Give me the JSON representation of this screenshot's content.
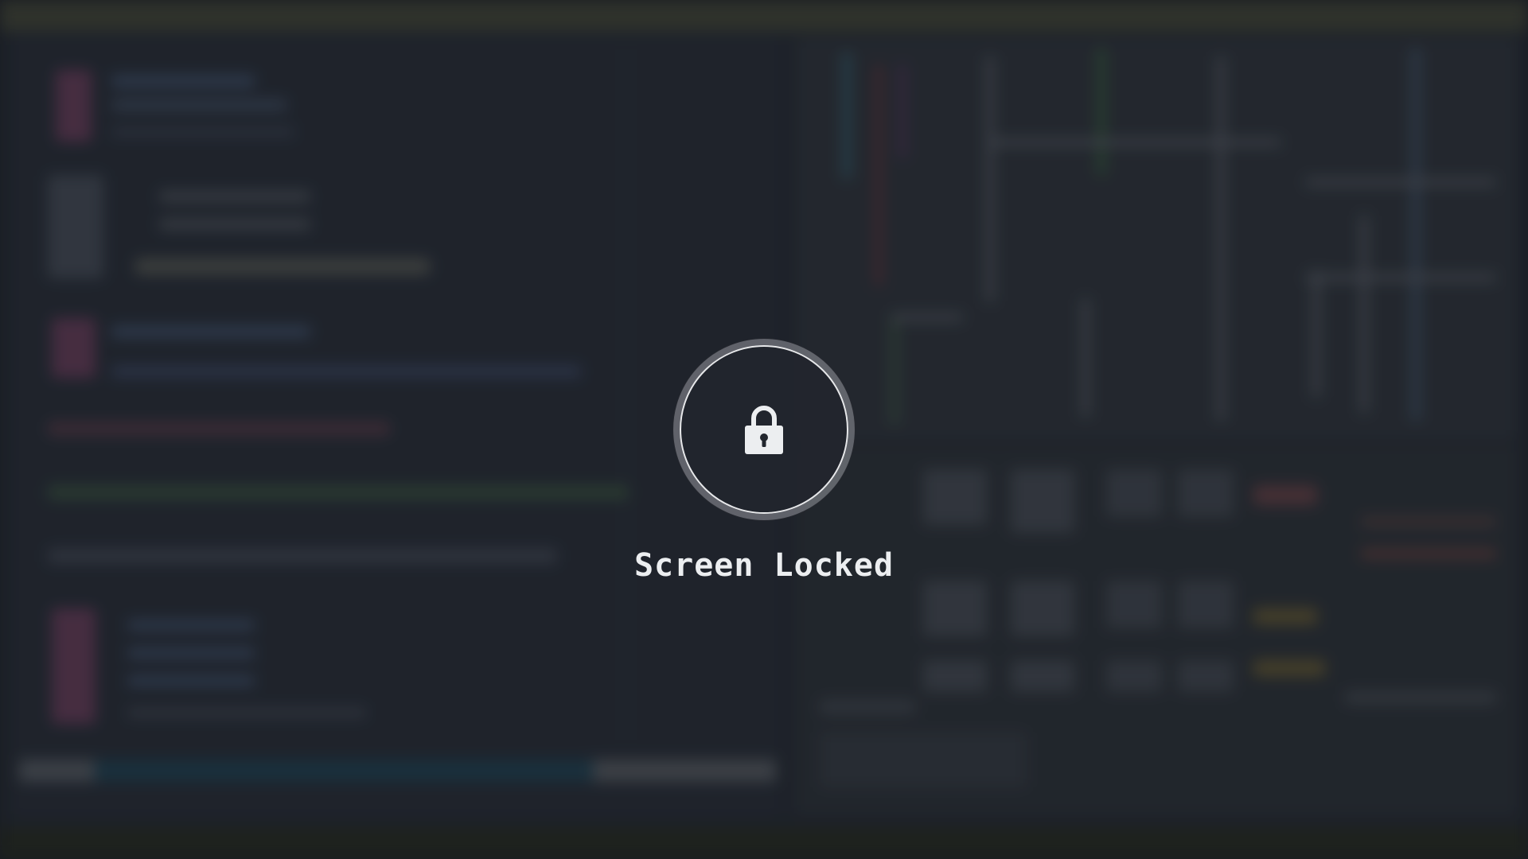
{
  "lock_screen": {
    "icon": "lock-icon",
    "label": "Screen Locked",
    "text_color": "#eceef0",
    "ring_color": "#e7e8ea"
  },
  "background": {
    "description_color": "#222730",
    "state": "blurred"
  }
}
